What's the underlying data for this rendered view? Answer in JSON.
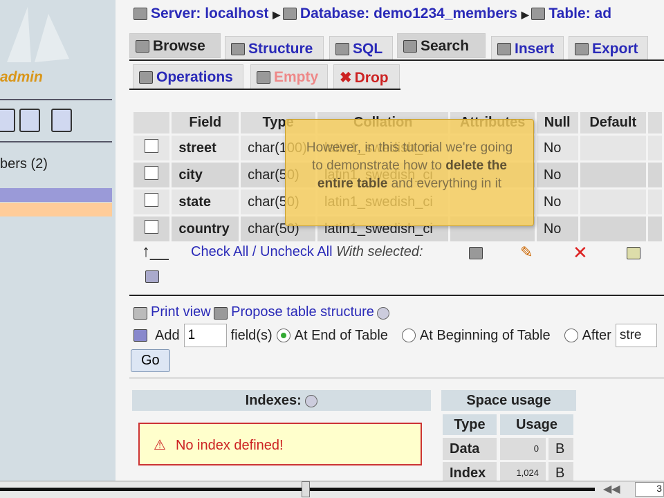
{
  "sidebar": {
    "logo": "admin",
    "db_item": "bers (2)"
  },
  "breadcrumb": {
    "server": "Server: localhost",
    "database": "Database: demo1234_members",
    "table": "Table: ad"
  },
  "tabs": [
    {
      "label": "Browse"
    },
    {
      "label": "Structure"
    },
    {
      "label": "SQL"
    },
    {
      "label": "Search"
    },
    {
      "label": "Insert"
    },
    {
      "label": "Export"
    }
  ],
  "tabs2": [
    {
      "label": "Operations"
    },
    {
      "label": "Empty"
    },
    {
      "label": "Drop"
    }
  ],
  "table": {
    "headers": [
      "",
      "Field",
      "Type",
      "Collation",
      "Attributes",
      "Null",
      "Default",
      ""
    ],
    "rows": [
      {
        "field": "street",
        "type": "char(100)",
        "collation": "latin1_swedish_ci",
        "null": "No"
      },
      {
        "field": "city",
        "type": "char(50)",
        "collation": "latin1_swedish_ci",
        "null": "No"
      },
      {
        "field": "state",
        "type": "char(50)",
        "collation": "latin1_swedish_ci",
        "null": "No"
      },
      {
        "field": "country",
        "type": "char(50)",
        "collation": "latin1_swedish_ci",
        "null": "No"
      }
    ]
  },
  "tooltip": {
    "line1": "However, in this tutorial we're going to demonstrate how to",
    "bold": "delete the entire table",
    "line2": "and everything in it"
  },
  "actions": {
    "check_all": "Check All",
    "sep": " / ",
    "uncheck_all": "Uncheck All",
    "with_selected": "With selected:"
  },
  "links": {
    "print_view": "Print view",
    "propose": "Propose table structure"
  },
  "add": {
    "label": "Add",
    "value": "1",
    "fields": "field(s)",
    "end": "At End of Table",
    "begin": "At Beginning of Table",
    "after": "After",
    "after_value": "stre",
    "go": "Go"
  },
  "indexes": {
    "title": "Indexes:",
    "warning": "No index defined!"
  },
  "space": {
    "title": "Space usage",
    "headers": [
      "Type",
      "Usage"
    ],
    "rows": [
      {
        "type": "Data",
        "value": "0",
        "unit": "B"
      },
      {
        "type": "Index",
        "value": "1,024",
        "unit": "B"
      }
    ]
  },
  "player": {
    "rewind": "◀◀",
    "time": "3"
  }
}
